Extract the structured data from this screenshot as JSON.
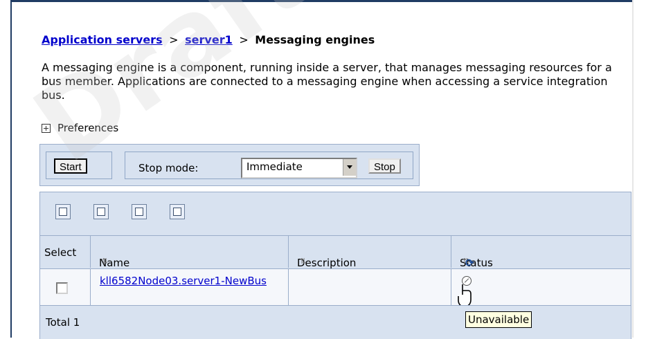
{
  "breadcrumb": {
    "link1": "Application servers",
    "sep1": ">",
    "link2": "server1",
    "sep2": ">",
    "current": "Messaging engines"
  },
  "description": "A messaging engine is a component, running inside a server, that manages messaging resources for a bus member. Applications are connected to a messaging engine when accessing a service integration bus.",
  "preferences_label": "Preferences",
  "toolbar": {
    "start_label": "Start",
    "stop_mode_label": "Stop mode:",
    "stop_mode_value": "Immediate",
    "stop_label": "Stop"
  },
  "table": {
    "headers": {
      "select": "Select",
      "name": "Name",
      "description": "Description",
      "status": "Status"
    },
    "rows": [
      {
        "name": "kll6582Node03.server1-NewBus",
        "description": "",
        "status_icon": "unavailable-icon"
      }
    ],
    "total_label": "Total 1"
  },
  "tooltip": "Unavailable",
  "watermark": "Draft"
}
